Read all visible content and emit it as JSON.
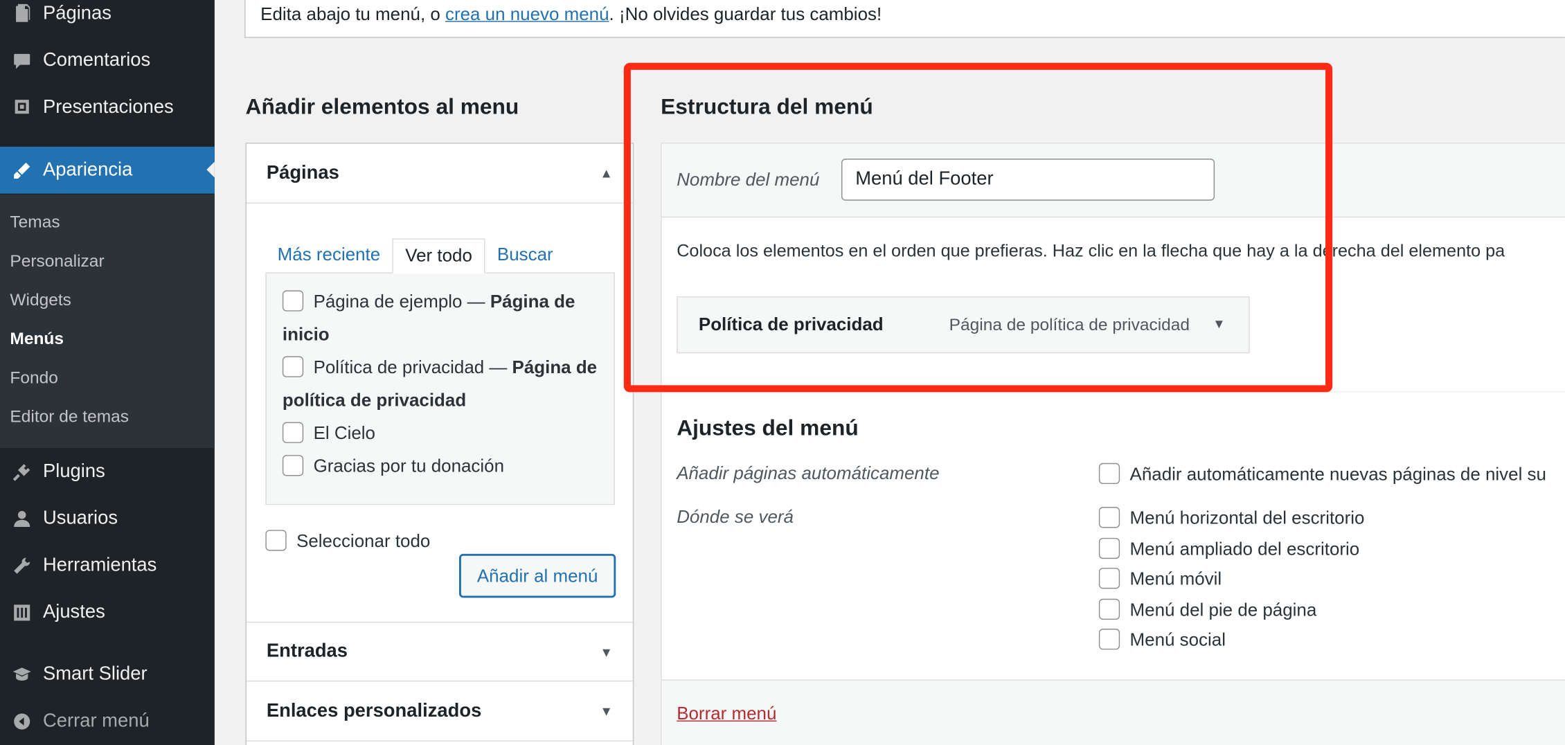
{
  "sidebar": {
    "items": [
      {
        "label": "Páginas",
        "icon": "pages-icon"
      },
      {
        "label": "Comentarios",
        "icon": "comments-icon"
      },
      {
        "label": "Presentaciones",
        "icon": "presentations-icon"
      },
      {
        "label": "Apariencia",
        "icon": "appearance-brush-icon"
      },
      {
        "label": "Plugins",
        "icon": "plugins-icon"
      },
      {
        "label": "Usuarios",
        "icon": "users-icon"
      },
      {
        "label": "Herramientas",
        "icon": "tools-wrench-icon"
      },
      {
        "label": "Ajustes",
        "icon": "settings-sliders-icon"
      },
      {
        "label": "Smart Slider",
        "icon": "smart-slider-icon"
      },
      {
        "label": "Cerrar menú",
        "icon": "collapse-menu-icon"
      }
    ],
    "submenu": [
      "Temas",
      "Personalizar",
      "Widgets",
      "Menús",
      "Fondo",
      "Editor de temas"
    ]
  },
  "notice": {
    "before": "Edita abajo tu menú, o ",
    "link": "crea un nuevo menú",
    "after": ". ¡No olvides guardar tus cambios!"
  },
  "add_items": {
    "heading": "Añadir elementos al menu",
    "pages_section": "Páginas",
    "tabs": [
      "Más reciente",
      "Ver todo",
      "Buscar"
    ],
    "pages": [
      {
        "name": "Página de ejemplo — ",
        "bold": "Página de inicio"
      },
      {
        "name": "Política de privacidad — ",
        "bold": "Página de política de privacidad"
      },
      {
        "name": "El Cielo",
        "bold": ""
      },
      {
        "name": "Gracias por tu donación",
        "bold": ""
      }
    ],
    "select_all": "Seleccionar todo",
    "add_button": "Añadir al menú",
    "sections": [
      "Entradas",
      "Enlaces personalizados"
    ]
  },
  "structure": {
    "heading": "Estructura del menú",
    "name_label": "Nombre del menú",
    "name_value": "Menú del Footer",
    "instructions": "Coloca los elementos en el orden que prefieras. Haz clic en la flecha que hay a la derecha del elemento pa",
    "item_title": "Política de privacidad",
    "item_type": "Página de política de privacidad"
  },
  "settings": {
    "heading": "Ajustes del menú",
    "auto_label": "Añadir páginas automáticamente",
    "auto_option": "Añadir automáticamente nuevas páginas de nivel su",
    "where_label": "Dónde se verá",
    "locations": [
      "Menú horizontal del escritorio",
      "Menú ampliado del escritorio",
      "Menú móvil",
      "Menú del pie de página",
      "Menú social"
    ]
  },
  "delete_link": "Borrar menú",
  "colors": {
    "sidebar": "#1d2327",
    "accent": "#2271b1",
    "highlight_box": "#ff2a14",
    "delete": "#b32d2e"
  }
}
